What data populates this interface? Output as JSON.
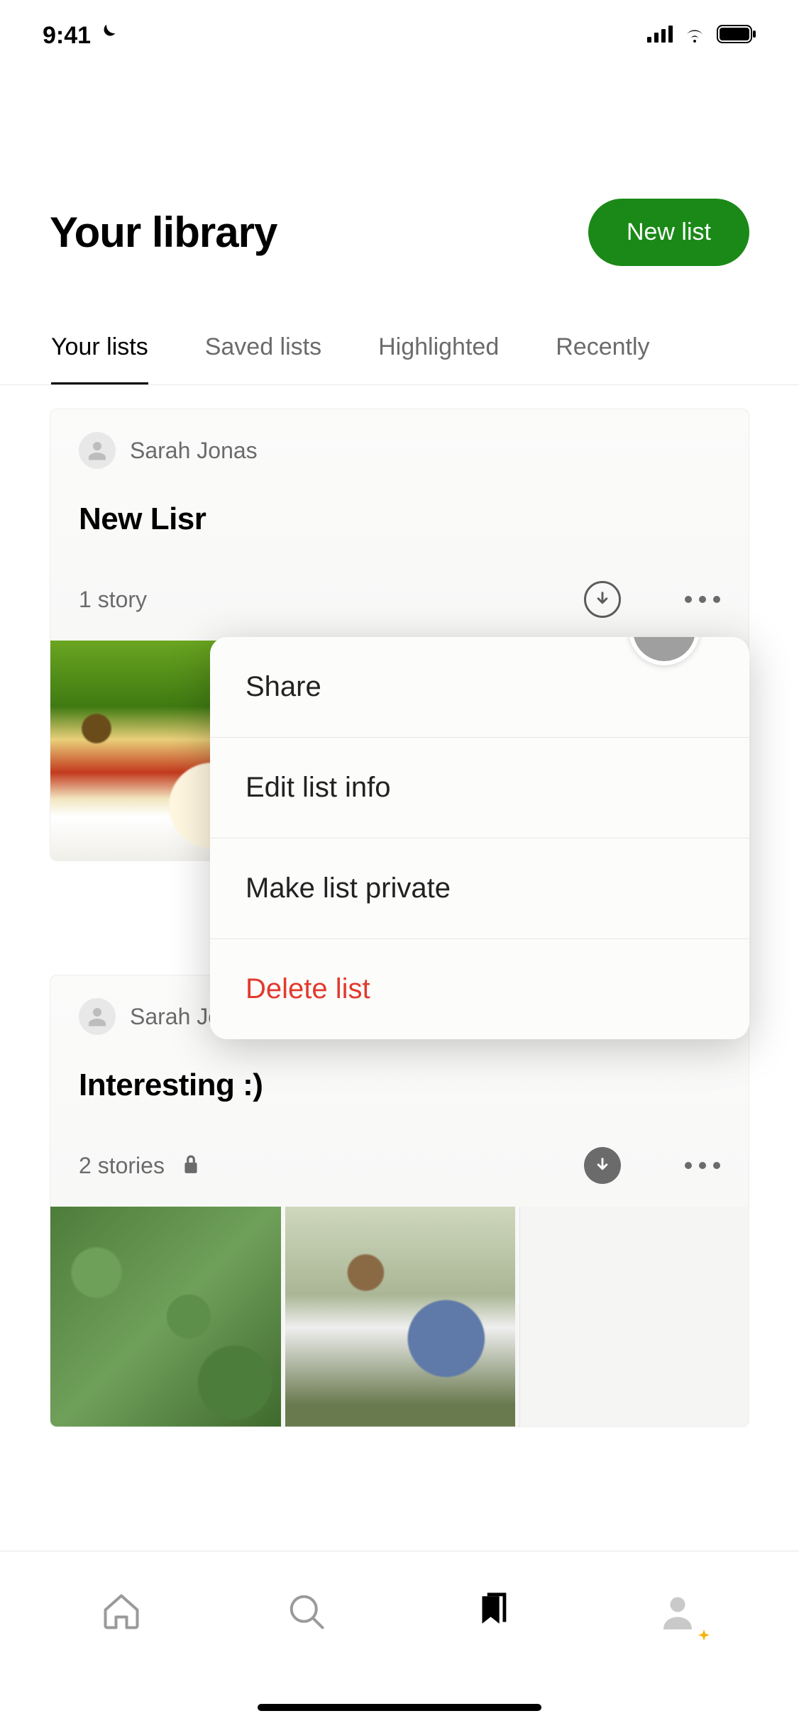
{
  "status_bar": {
    "time": "9:41"
  },
  "header": {
    "title": "Your library",
    "new_list_label": "New list"
  },
  "tabs": {
    "items": [
      {
        "label": "Your lists",
        "active": true
      },
      {
        "label": "Saved lists",
        "active": false
      },
      {
        "label": "Highlighted",
        "active": false
      },
      {
        "label": "Recently",
        "active": false
      }
    ]
  },
  "lists": [
    {
      "author": "Sarah Jonas",
      "title": "New Lisr",
      "story_count_label": "1 story",
      "private": false,
      "thumbs": [
        "pasta"
      ]
    },
    {
      "author": "Sarah Jonas",
      "title": "Interesting :)",
      "story_count_label": "2 stories",
      "private": true,
      "thumbs": [
        "kale",
        "person"
      ]
    }
  ],
  "context_menu": {
    "items": [
      {
        "label": "Share",
        "destructive": false
      },
      {
        "label": "Edit list info",
        "destructive": false
      },
      {
        "label": "Make list private",
        "destructive": false
      },
      {
        "label": "Delete list",
        "destructive": true
      }
    ]
  },
  "bottom_nav": {
    "tabs": [
      "home",
      "search",
      "library",
      "profile"
    ],
    "active": "library"
  },
  "colors": {
    "accent": "#1a8917",
    "destructive": "#e23a2e"
  }
}
